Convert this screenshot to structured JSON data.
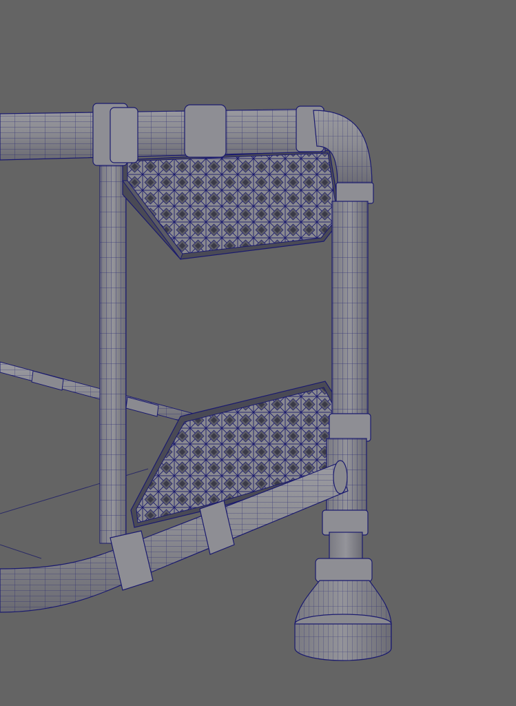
{
  "viewport": {
    "background": "#646464",
    "surface_color": "#8a8a8e",
    "surface_dark": "#6e6e74",
    "wire_color": "#1a1a6e",
    "grid_color": "#2a2a66"
  }
}
